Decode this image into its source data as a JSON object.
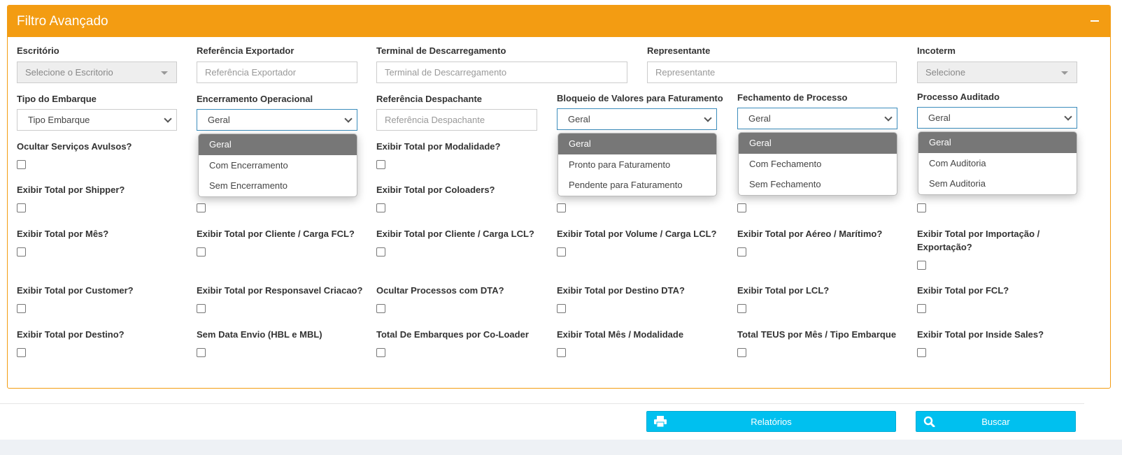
{
  "panel": {
    "title": "Filtro Avançado"
  },
  "row1": {
    "escritorio": {
      "label": "Escritório",
      "placeholder": "Selecione o Escritorio"
    },
    "ref_exportador": {
      "label": "Referência Exportador",
      "placeholder": "Referência Exportador"
    },
    "terminal": {
      "label": "Terminal de Descarregamento",
      "placeholder": "Terminal de Descarregamento"
    },
    "representante": {
      "label": "Representante",
      "placeholder": "Representante"
    },
    "incoterm": {
      "label": "Incoterm",
      "placeholder": "Selecione"
    }
  },
  "row2": {
    "tipo_embarque": {
      "label": "Tipo do Embarque",
      "value": "Tipo Embarque"
    },
    "encerramento": {
      "label": "Encerramento Operacional",
      "value": "Geral",
      "options": [
        "Geral",
        "Com Encerramento",
        "Sem Encerramento"
      ]
    },
    "ref_despachante": {
      "label": "Referência Despachante",
      "placeholder": "Referência Despachante"
    },
    "bloqueio": {
      "label": "Bloqueio de Valores para Faturamento",
      "value": "Geral",
      "options": [
        "Geral",
        "Pronto para Faturamento",
        "Pendente para Faturamento"
      ]
    },
    "fechamento": {
      "label": "Fechamento de Processo",
      "value": "Geral",
      "options": [
        "Geral",
        "Com Fechamento",
        "Sem Fechamento"
      ]
    },
    "auditado": {
      "label": "Processo Auditado",
      "value": "Geral",
      "options": [
        "Geral",
        "Com Auditoria",
        "Sem Auditoria"
      ]
    }
  },
  "checks": {
    "r3": [
      "Ocultar Serviços Avulsos?",
      "Exibir Total por Modalidade?"
    ],
    "r4": [
      "Exibir Total por Shipper?",
      "Exibir Total por Coloaders?"
    ],
    "r5": [
      "Exibir Total por Mês?",
      "Exibir Total por Cliente / Carga FCL?",
      "Exibir Total por Cliente / Carga LCL?",
      "Exibir Total por Volume / Carga LCL?",
      "Exibir Total por Aéreo / Marítimo?",
      "Exibir Total por Importação / Exportação?"
    ],
    "r6": [
      "Exibir Total por Customer?",
      "Exibir Total por Responsavel Criacao?",
      "Ocultar Processos com DTA?",
      "Exibir Total por Destino DTA?",
      "Exibir Total por LCL?",
      "Exibir Total por FCL?"
    ],
    "r7": [
      "Exibir Total por Destino?",
      "Sem Data Envio (HBL e MBL)",
      "Total De Embarques por Co-Loader",
      "Exibir Total Mês / Modalidade",
      "Total TEUS por Mês / Tipo Embarque",
      "Exibir Total por Inside Sales?"
    ]
  },
  "footer": {
    "relatorios_label": "Relatórios",
    "buscar_label": "Buscar"
  },
  "icons": {
    "collapse": "minus-icon",
    "relatorios": "printer-icon",
    "buscar": "search-icon"
  },
  "colors": {
    "header": "#f39c12",
    "button": "#00c0ef",
    "selected_option": "#777777"
  }
}
